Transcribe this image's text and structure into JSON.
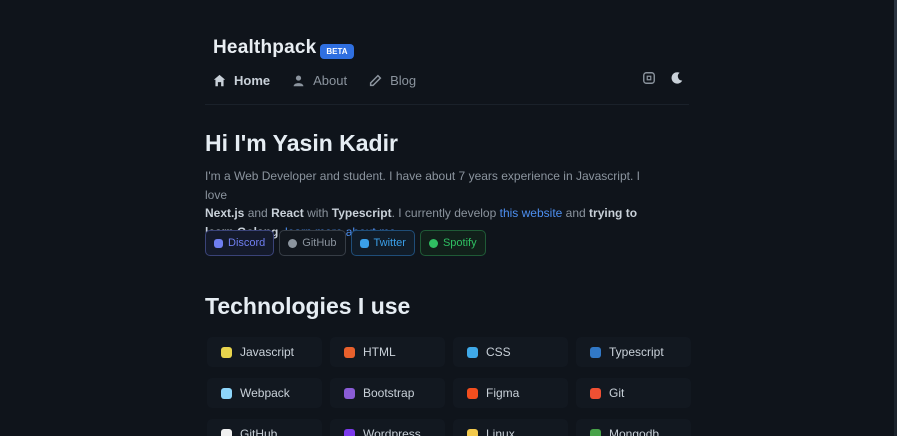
{
  "brand": {
    "name": "Healthpack",
    "badge": "Beta"
  },
  "nav": {
    "items": [
      {
        "label": "Home",
        "icon": "home-icon",
        "active": true
      },
      {
        "label": "About",
        "icon": "user-icon",
        "active": false
      },
      {
        "label": "Blog",
        "icon": "pen-icon",
        "active": false
      }
    ]
  },
  "header_actions": [
    {
      "icon": "command-icon"
    },
    {
      "icon": "moon-icon"
    }
  ],
  "hero": {
    "title": "Hi I'm Yasin Kadir",
    "intro": "I'm a Web Developer and student. I have about 7 years experience in Javascript. I love",
    "skill_1": "Next.js",
    "and_1": " and ",
    "skill_2": "React",
    "with": " with ",
    "skill_3": "Typescript",
    "develop": ". I currently develop ",
    "website_link": "this website",
    "and_2": " and ",
    "learning": "trying to learn Golang",
    "sep": ". ",
    "more_link": "learn more about me"
  },
  "socials": [
    {
      "label": "Discord",
      "color": "#6f7ef0"
    },
    {
      "label": "GitHub",
      "color": "#8b949e"
    },
    {
      "label": "Twitter",
      "color": "#3a9fe8"
    },
    {
      "label": "Spotify",
      "color": "#2fbf62"
    }
  ],
  "technologies": {
    "title": "Technologies I use",
    "items": [
      {
        "label": "Javascript",
        "color": "#e8d44d"
      },
      {
        "label": "HTML",
        "color": "#e8602c"
      },
      {
        "label": "CSS",
        "color": "#3fa9e8"
      },
      {
        "label": "Typescript",
        "color": "#3178c6"
      },
      {
        "label": "Webpack",
        "color": "#8ed6fb"
      },
      {
        "label": "Bootstrap",
        "color": "#8a5cd6"
      },
      {
        "label": "Figma",
        "color": "#f24e1e"
      },
      {
        "label": "Git",
        "color": "#f05033"
      },
      {
        "label": "GitHub",
        "color": "#f0f0f0"
      },
      {
        "label": "Wordpress",
        "color": "#7c3aed"
      },
      {
        "label": "Linux",
        "color": "#f2c94c"
      },
      {
        "label": "Mongodb",
        "color": "#47a248"
      }
    ]
  }
}
